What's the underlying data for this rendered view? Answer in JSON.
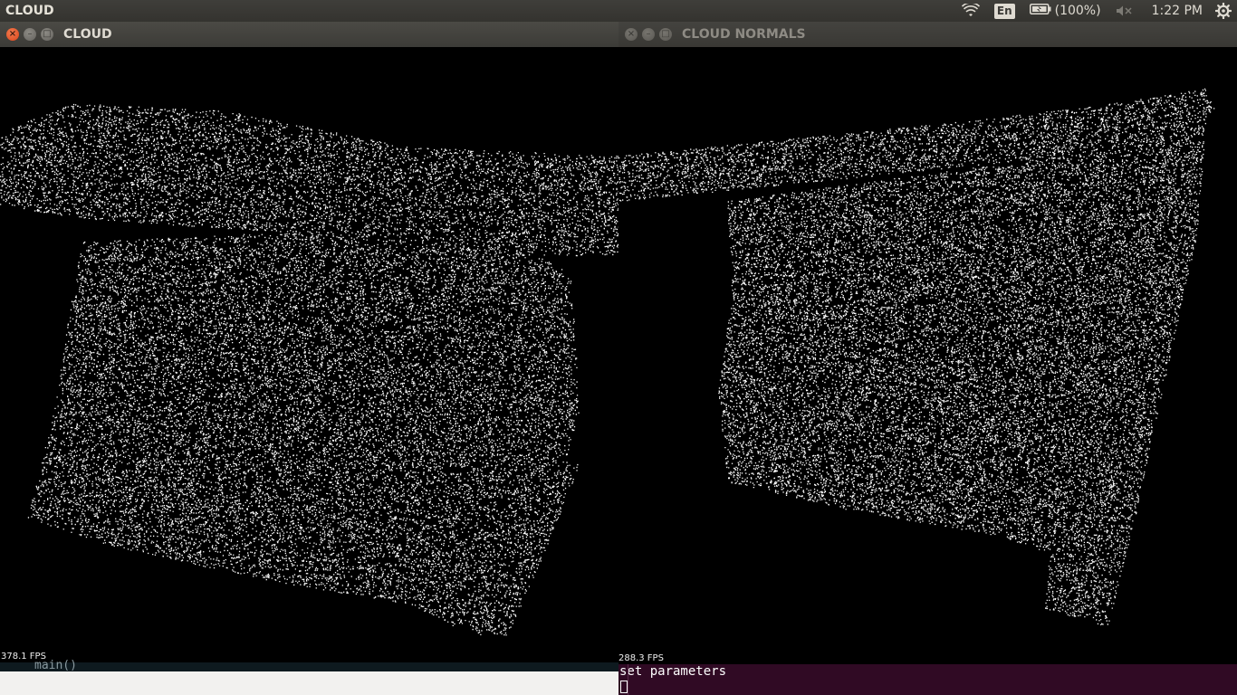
{
  "top_panel": {
    "app_title": "CLOUD",
    "language": "En",
    "battery": "(100%)",
    "time": "1:22 PM",
    "icons": [
      "wifi-icon",
      "battery-icon",
      "volume-muted-icon",
      "settings-gear-icon"
    ]
  },
  "window_left": {
    "title": "CLOUD",
    "fps": "378.1 FPS"
  },
  "window_right": {
    "title": "CLOUD NORMALS",
    "fps": "288.3 FPS"
  },
  "terminal_left": {
    "line": "main()"
  },
  "terminal_right": {
    "line": "set parameters"
  },
  "colors": {
    "panel_bg": "#3c3b37",
    "titlebar_bg": "#3c3b37",
    "close_button": "#e8542a",
    "viewport_bg": "#000000",
    "points": "#ffffff",
    "terminal_bg": "#300a24"
  }
}
